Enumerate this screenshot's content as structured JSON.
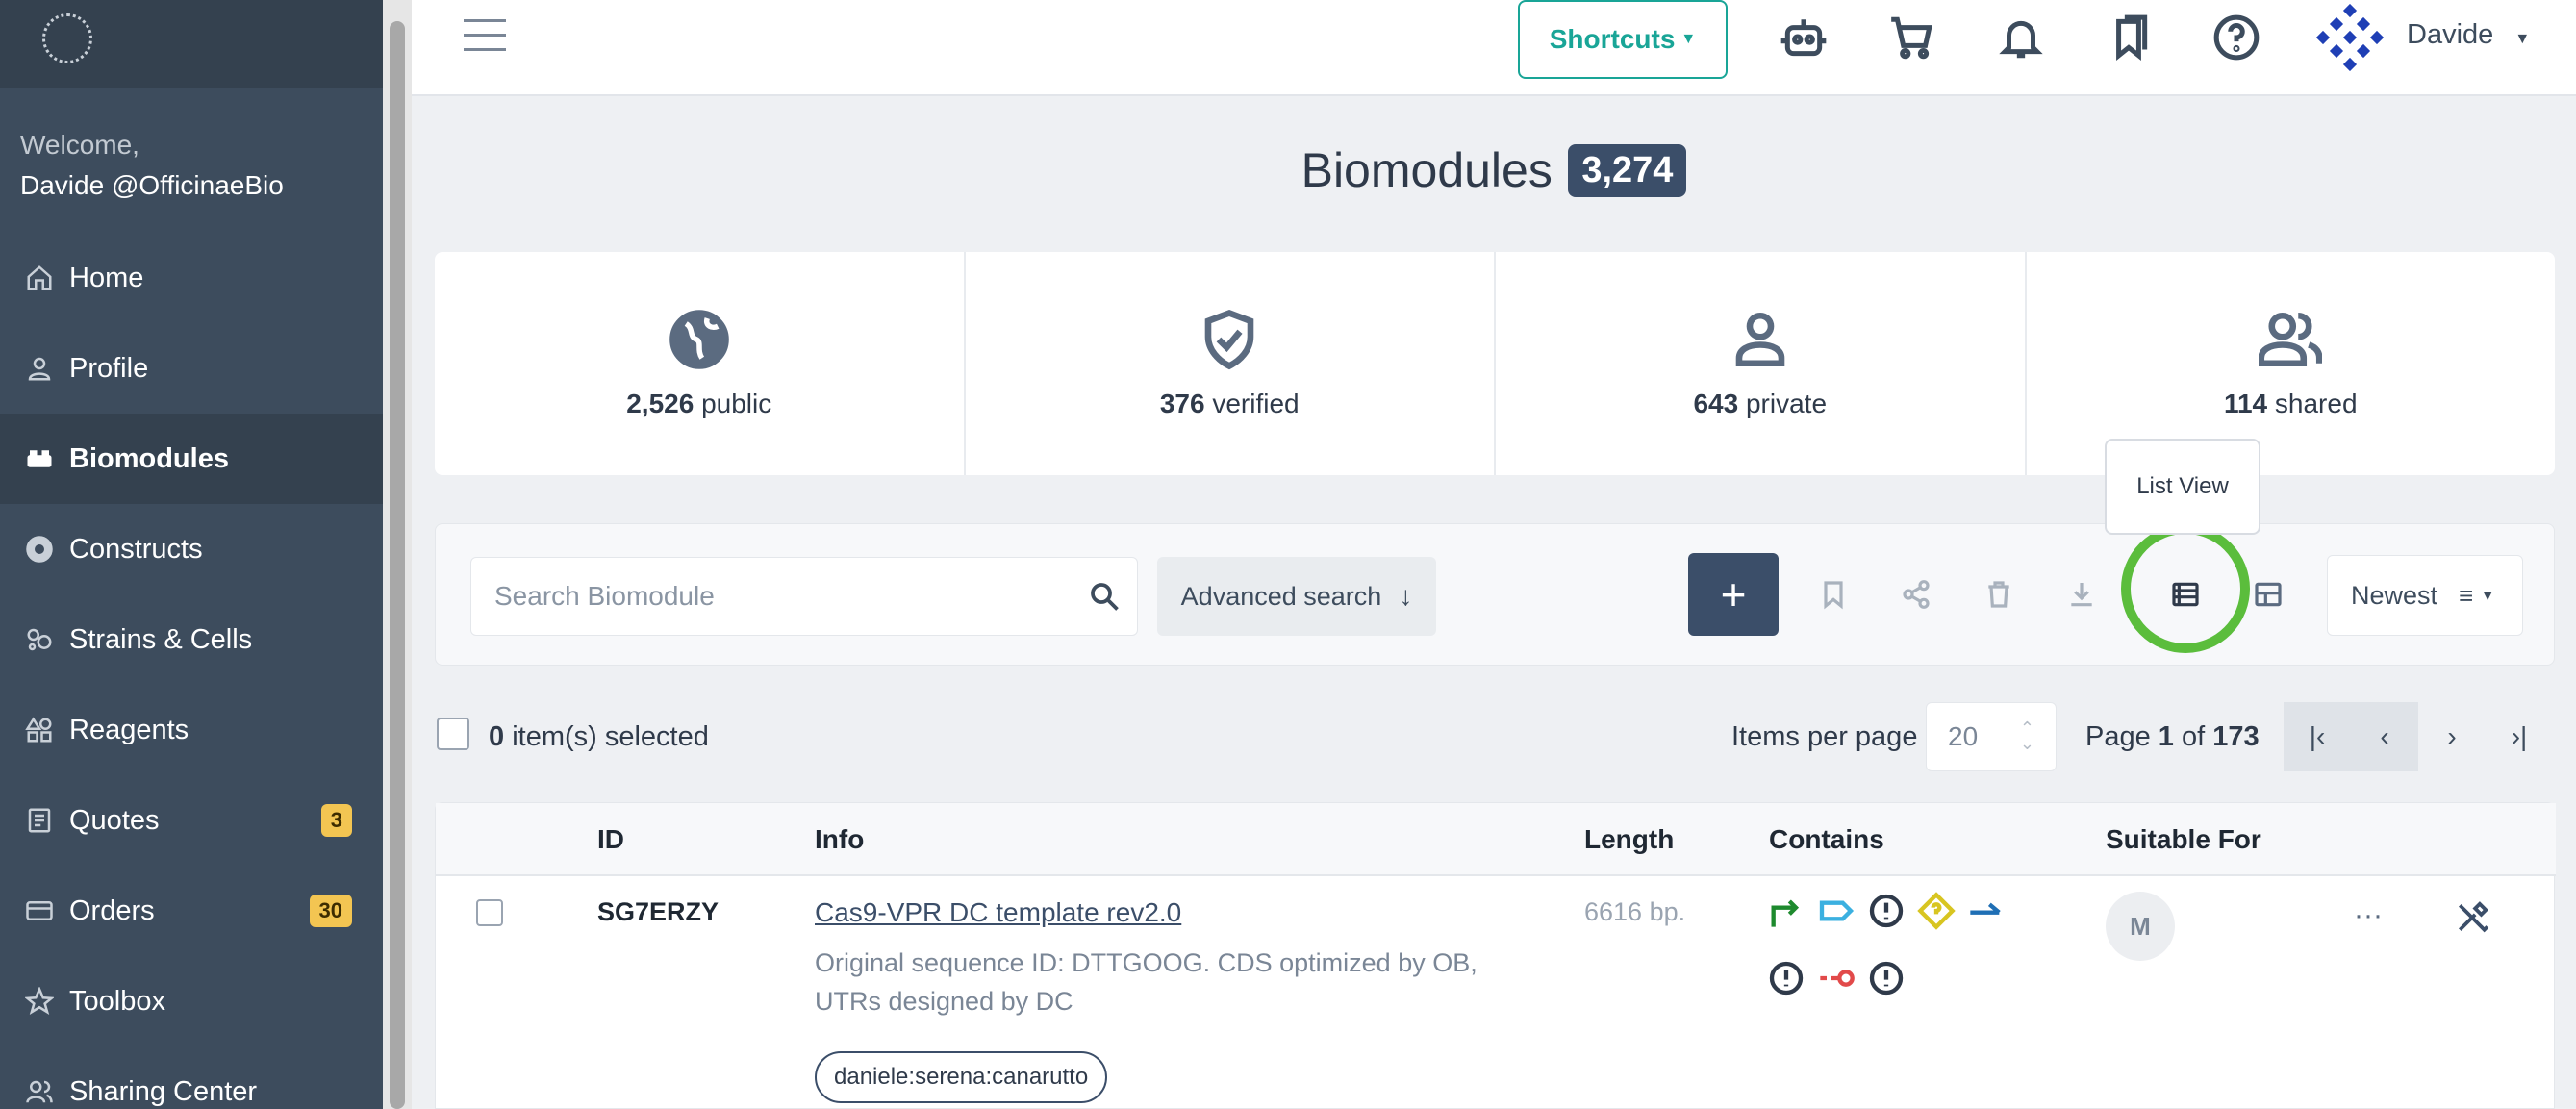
{
  "sidebar": {
    "welcome_line1": "Welcome,",
    "welcome_line2": "Davide @OfficinaeBio",
    "items": [
      {
        "label": "Home",
        "icon": "home-icon"
      },
      {
        "label": "Profile",
        "icon": "user-icon"
      },
      {
        "label": "Biomodules",
        "icon": "bricks-icon",
        "active": true
      },
      {
        "label": "Constructs",
        "icon": "plasmid-icon"
      },
      {
        "label": "Strains & Cells",
        "icon": "cells-icon"
      },
      {
        "label": "Reagents",
        "icon": "shapes-icon"
      },
      {
        "label": "Quotes",
        "icon": "document-icon",
        "badge": "3"
      },
      {
        "label": "Orders",
        "icon": "card-icon",
        "badge": "30"
      },
      {
        "label": "Toolbox",
        "icon": "star-icon"
      },
      {
        "label": "Sharing Center",
        "icon": "users-icon"
      }
    ]
  },
  "header": {
    "shortcuts_label": "Shortcuts",
    "username": "Davide",
    "icons": [
      "robot-icon",
      "cart-icon",
      "bell-icon",
      "bookmarks-icon",
      "help-icon"
    ]
  },
  "page": {
    "title": "Biomodules",
    "count": "3,274"
  },
  "stats": [
    {
      "value": "2,526",
      "label": "public",
      "icon": "globe-icon"
    },
    {
      "value": "376",
      "label": "verified",
      "icon": "shield-check-icon"
    },
    {
      "value": "643",
      "label": "private",
      "icon": "person-icon"
    },
    {
      "value": "114",
      "label": "shared",
      "icon": "people-icon"
    }
  ],
  "tooltip": "List View",
  "toolbar": {
    "search_placeholder": "Search Biomodule",
    "advanced_search": "Advanced search",
    "add_label": "+",
    "sort_label": "Newest"
  },
  "selection": {
    "count": "0",
    "label": "item(s) selected",
    "items_per_page_label": "Items per page",
    "items_per_page": "20",
    "page_prefix": "Page",
    "page_current": "1",
    "page_of": "of",
    "page_total": "173"
  },
  "table": {
    "columns": [
      "ID",
      "Info",
      "Length",
      "Contains",
      "Suitable For"
    ],
    "rows": [
      {
        "id": "SG7ERZY",
        "name": "Cas9-VPR DC template rev2.0",
        "description": "Original sequence ID: DTTGOOG. CDS optimized by OB, UTRs designed by DC",
        "tag": "daniele:serena:canarutto",
        "length": "6616 bp.",
        "suitable": "M"
      }
    ]
  },
  "colors": {
    "sidebar": "#3d4c5d",
    "accent_teal": "#19a597",
    "primary": "#3b4e69",
    "badge": "#f3c552",
    "highlight_ring": "#5bbd3c"
  }
}
